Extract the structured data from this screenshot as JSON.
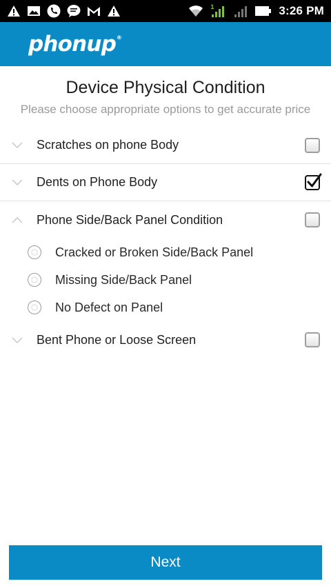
{
  "status_bar": {
    "time": "3:26 PM",
    "sim_badge": "1",
    "left_icons": [
      "warning-icon",
      "gallery-icon",
      "phone-call-icon",
      "message-icon",
      "gmail-icon",
      "warning-icon"
    ],
    "right_icons": [
      "wifi-icon",
      "signal-sim1-icon",
      "signal-sim2-icon",
      "battery-icon"
    ]
  },
  "header": {
    "logo": "phonup",
    "logo_mark": "®",
    "color": "#0a8bc6"
  },
  "page": {
    "title": "Device Physical Condition",
    "subtitle": "Please choose appropriate options to get accurate price"
  },
  "conditions": [
    {
      "label": "Scratches on phone Body",
      "expanded": false,
      "checked": false
    },
    {
      "label": "Dents on Phone Body",
      "expanded": false,
      "checked": true
    },
    {
      "label": "Phone Side/Back Panel Condition",
      "expanded": true,
      "checked": false,
      "options": [
        {
          "label": "Cracked or Broken Side/Back Panel",
          "selected": false
        },
        {
          "label": "Missing Side/Back Panel",
          "selected": false
        },
        {
          "label": "No Defect on Panel",
          "selected": false
        }
      ]
    },
    {
      "label": "Bent Phone or Loose Screen",
      "expanded": false,
      "checked": false
    }
  ],
  "footer": {
    "next_label": "Next"
  }
}
